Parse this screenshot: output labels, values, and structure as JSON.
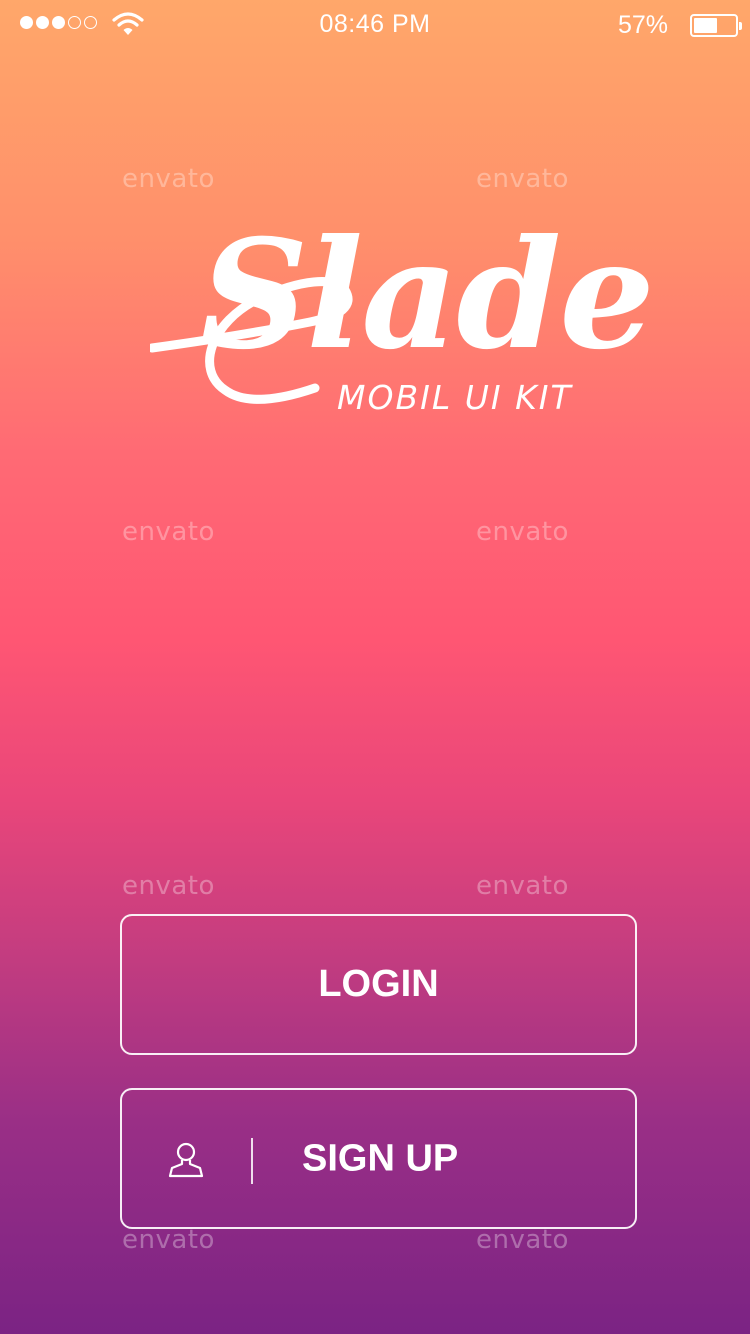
{
  "status_bar": {
    "signal_filled": 3,
    "signal_total": 5,
    "time": "08:46 PM",
    "battery_percent": "57%",
    "battery_level": 0.57
  },
  "watermark": {
    "text": "envato"
  },
  "logo": {
    "wordmark": "Slade",
    "subtitle": "MOBIL UI KIT"
  },
  "buttons": {
    "login_label": "LOGIN",
    "signup_label": "SIGN UP",
    "signup_icon": "user-icon"
  },
  "colors": {
    "gradient_top": "#ffa76a",
    "gradient_middle": "#ff5673",
    "gradient_bottom": "#7b2384",
    "foreground": "#ffffff"
  }
}
